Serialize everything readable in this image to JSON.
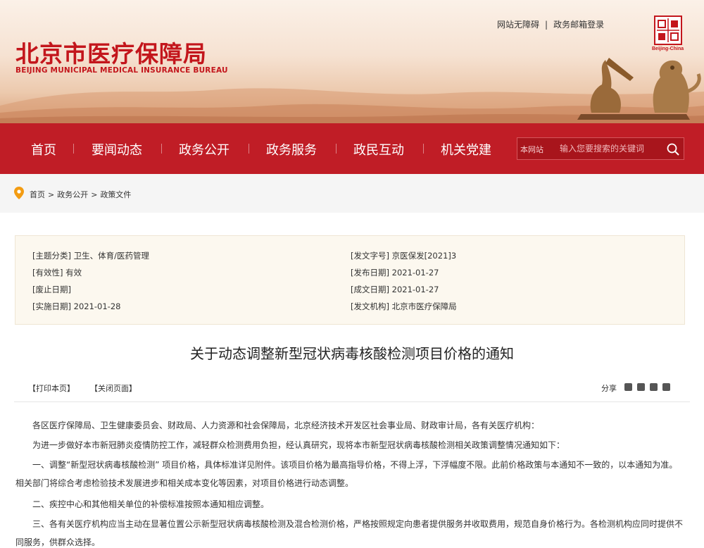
{
  "site": {
    "name_cn": "北京市医疗保障局",
    "name_en": "BEIJING MUNICIPAL MEDICAL INSURANCE BUREAU",
    "seal_caption": "Beijing-China"
  },
  "top_links": {
    "accessibility": "网站无障碍",
    "separator": "|",
    "mail_login": "政务邮箱登录"
  },
  "nav": {
    "items": [
      "首页",
      "要闻动态",
      "政务公开",
      "政务服务",
      "政民互动",
      "机关党建"
    ]
  },
  "search": {
    "scope": "本网站",
    "placeholder": "输入您要搜索的关键词"
  },
  "breadcrumb": {
    "items": [
      "首页",
      "政务公开",
      "政策文件"
    ],
    "separator": ">"
  },
  "meta": {
    "subject": "[主题分类] 卫生、体育/医药管理",
    "validity": "[有效性] 有效",
    "repeal_date": "[废止日期]",
    "effective_date": "[实施日期] 2021-01-28",
    "doc_number": "[发文字号] 京医保发[2021]3",
    "publish_date": "[发布日期] 2021-01-27",
    "creation_date": "[成文日期] 2021-01-27",
    "issuer": "[发文机构] 北京市医疗保障局"
  },
  "article": {
    "title": "关于动态调整新型冠状病毒核酸检测项目价格的通知",
    "print_label": "【打印本页】",
    "close_label": "【关闭页面】",
    "share_label": "分享",
    "paragraphs": [
      "各区医疗保障局、卫生健康委员会、财政局、人力资源和社会保障局，北京经济技术开发区社会事业局、财政审计局，各有关医疗机构：",
      "为进一步做好本市新冠肺炎疫情防控工作，减轻群众检测费用负担，经认真研究，现将本市新型冠状病毒核酸检测相关政策调整情况通知如下：",
      "一、调整“新型冠状病毒核酸检测” 项目价格，具体标准详见附件。该项目价格为最高指导价格，不得上浮，下浮幅度不限。此前价格政策与本通知不一致的，以本通知为准。相关部门将综合考虑检验技术发展进步和相关成本变化等因素，对项目价格进行动态调整。",
      "二、疾控中心和其他相关单位的补偿标准按照本通知相应调整。",
      "三、各有关医疗机构应当主动在显著位置公示新型冠状病毒核酸检测及混合检测价格，严格按照规定向患者提供服务并收取费用，规范自身价格行为。各检测机构应同时提供不同服务，供群众选择。"
    ]
  },
  "colors": {
    "brand_red": "#c01d26",
    "meta_bg": "#fcf8ef"
  }
}
